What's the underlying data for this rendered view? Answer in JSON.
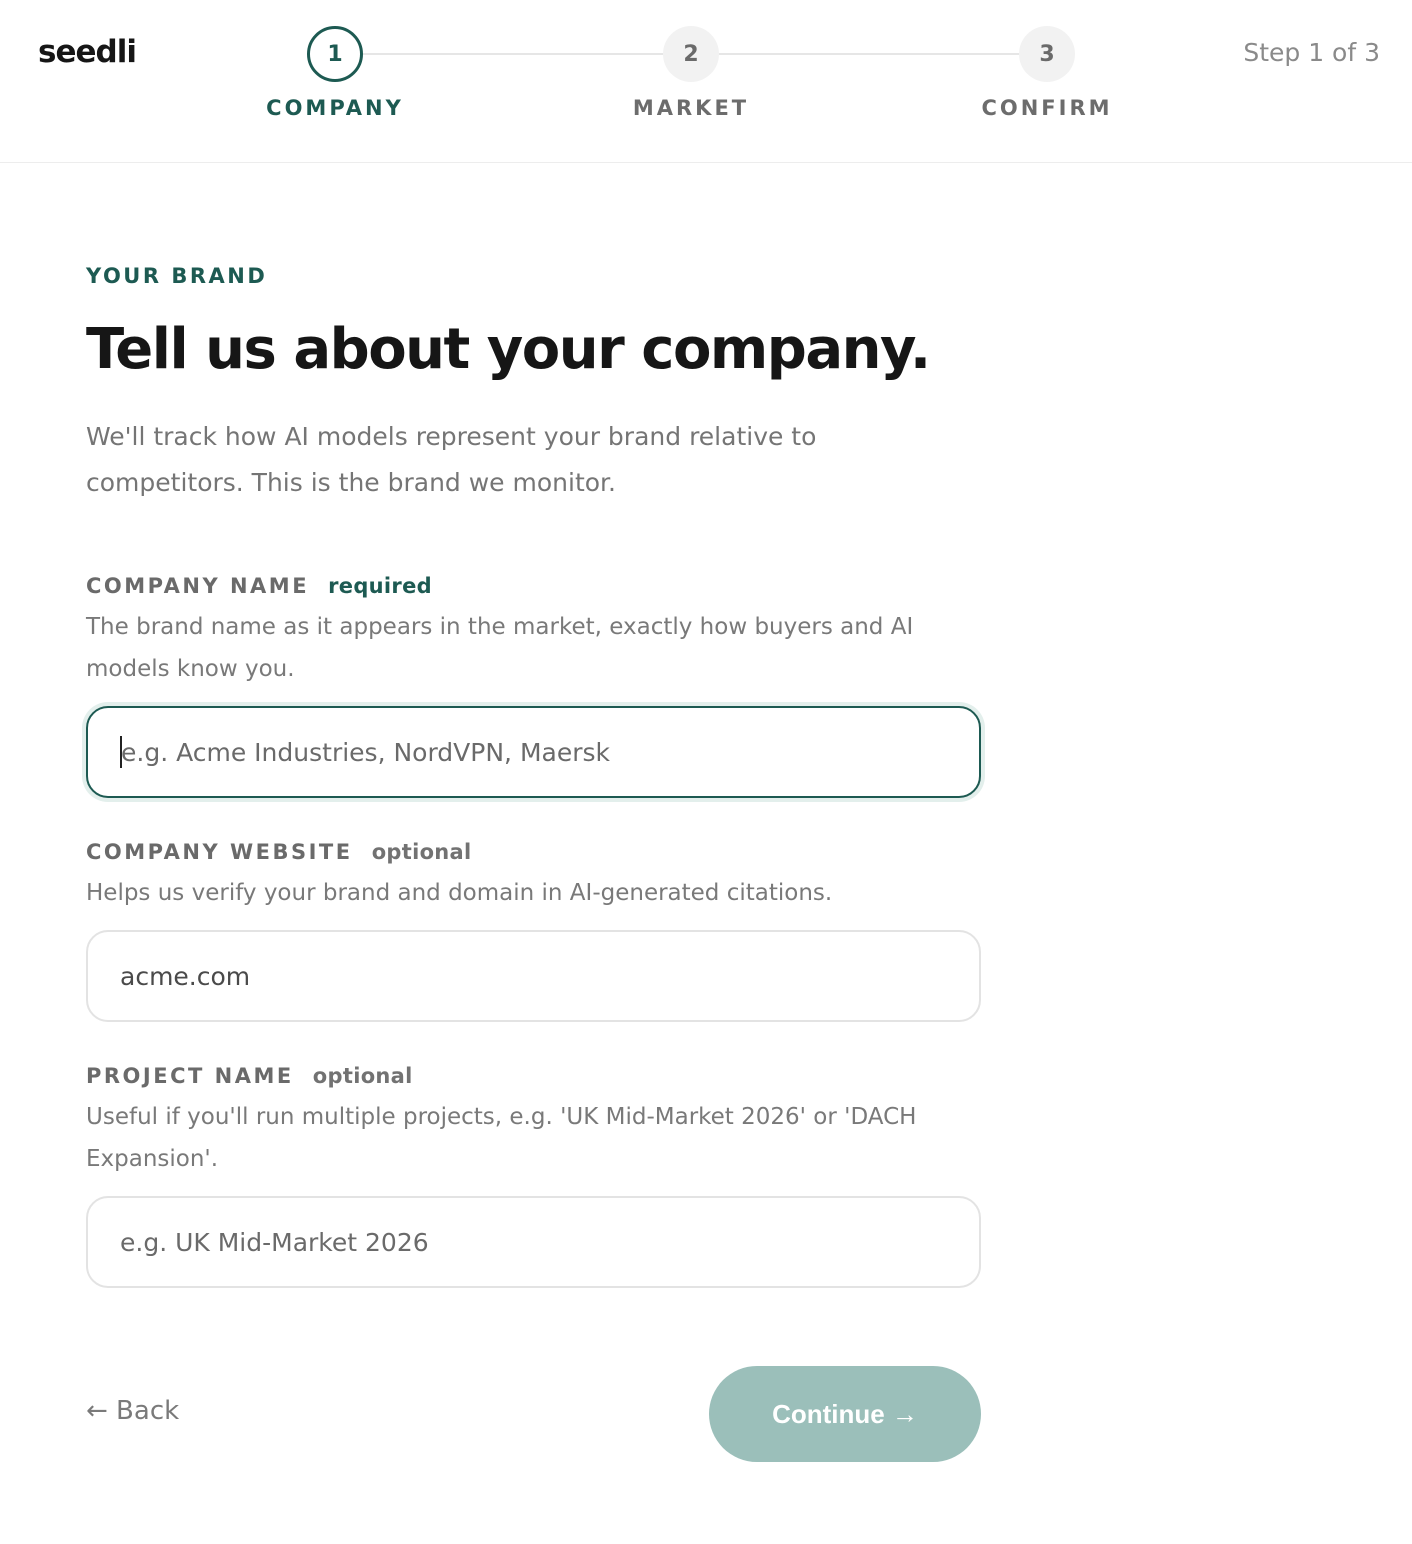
{
  "brand": {
    "logo_text": "seedli"
  },
  "stepper": {
    "counter": "Step 1 of 3",
    "steps": [
      {
        "number": "1",
        "label": "COMPANY",
        "state": "active"
      },
      {
        "number": "2",
        "label": "MARKET",
        "state": "upcoming"
      },
      {
        "number": "3",
        "label": "CONFIRM",
        "state": "upcoming"
      }
    ]
  },
  "header": {
    "eyebrow": "YOUR BRAND",
    "title": "Tell us about your company.",
    "intro": "We'll track how AI models represent your brand relative to competitors. This is the brand we monitor."
  },
  "form": {
    "company_name": {
      "label": "COMPANY NAME",
      "tag": "required",
      "help": "The brand name as it appears in the market, exactly how buyers and AI models know you.",
      "placeholder": "e.g. Acme Industries, NordVPN, Maersk",
      "value": ""
    },
    "company_website": {
      "label": "COMPANY WEBSITE",
      "tag": "optional",
      "help": "Helps us verify your brand and domain in AI-generated citations.",
      "value": "acme.com"
    },
    "project_name": {
      "label": "PROJECT NAME",
      "tag": "optional",
      "help": "Useful if you'll run multiple projects, e.g. 'UK Mid-Market 2026' or 'DACH Expansion'.",
      "placeholder": "e.g. UK Mid-Market 2026",
      "value": ""
    }
  },
  "actions": {
    "back_label": "← Back",
    "continue_label": "Continue →"
  },
  "colors": {
    "accent": "#1d5a52",
    "continue_disabled": "#9bbfba",
    "muted_text": "#757575"
  }
}
